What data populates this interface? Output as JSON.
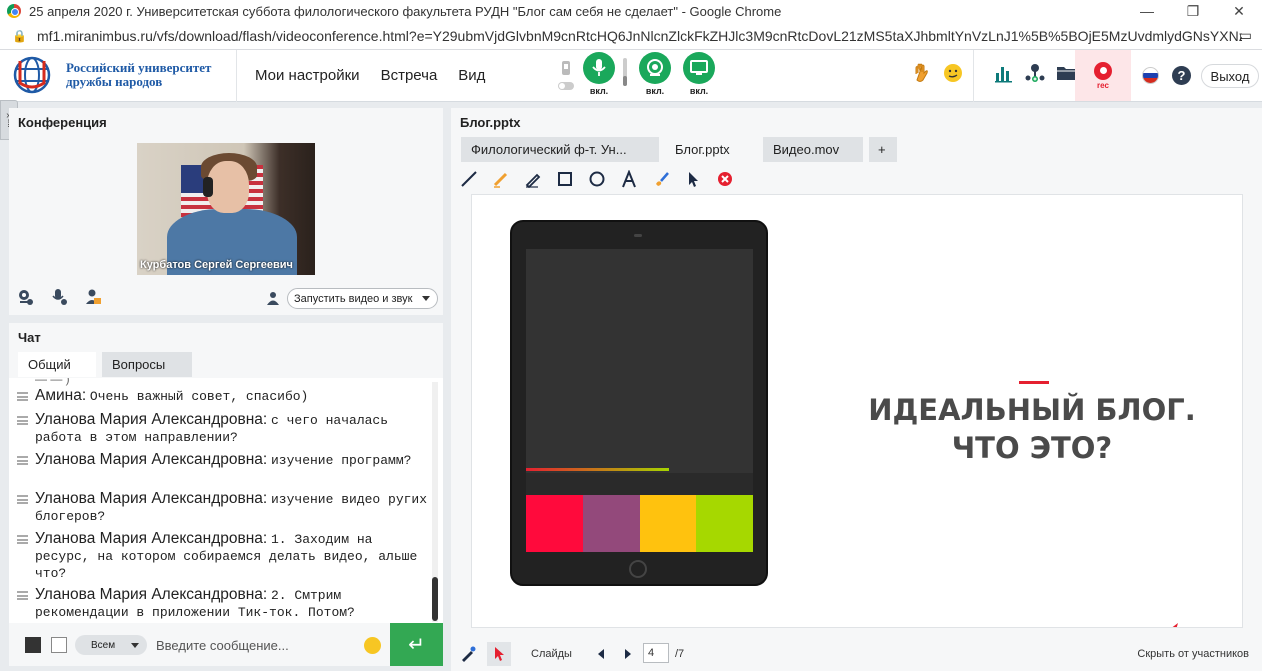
{
  "browser": {
    "title": "25 апреля 2020 г. Университетская суббота филологического факультета РУДН \"Блог сам себя не сделает\" - Google Chrome",
    "url": "mf1.miranimbus.ru/vfs/download/flash/videoconference.html?e=Y29ubmVjdGlvbnM9cnRtcHQ6JnNlcnZlckFkZHJlc3M9cnRtcDovL21zMS5taXJhbmltYnVzLnJ1%5B%5BOjE5MzUvdmlydGNsYXNzLy..."
  },
  "header": {
    "logo_line1": "Российский университет",
    "logo_line2": "дружбы народов",
    "menu": [
      "Мои настройки",
      "Встреча",
      "Вид"
    ],
    "mic_label": "вкл.",
    "cam_label": "вкл.",
    "screen_label": "вкл.",
    "rec_label": "rec",
    "exit_label": "Выход"
  },
  "conference": {
    "title": "Конференция",
    "participant_name": "Курбатов Сергей Сергеевич",
    "start_video_label": "Запустить видео и звук"
  },
  "chat": {
    "title": "Чат",
    "tabs": [
      "Общий",
      "Вопросы"
    ],
    "messages": [
      {
        "author": "Амина:",
        "text": "Очень важный совет, спасибо)"
      },
      {
        "author": "Уланова Мария  Александровна:",
        "text": "с чего началась работа в этом направлении?"
      },
      {
        "author": "Уланова Мария  Александровна:",
        "text": "изучение программ?"
      },
      {
        "author": "Уланова Мария  Александровна:",
        "text": "изучение видео ругих блогеров?"
      },
      {
        "author": "Уланова Мария  Александровна:",
        "text": "1. Заходим на ресурс, на котором собираемся делать видео, альше что?"
      },
      {
        "author": "Уланова Мария  Александровна:",
        "text": "2. Смтрим рекомендации в приложении Тик-ток. Потом?"
      }
    ],
    "recipient_select": "Всем",
    "input_placeholder": "Введите сообщение..."
  },
  "presentation": {
    "title": "Блог.pptx",
    "tabs": [
      "Филологический ф-т.  Ун...",
      "Блог.pptx",
      "Видео.mov",
      "+"
    ],
    "active_tab": 1,
    "slide_title_line1": "ИДЕАЛЬНЫЙ БЛОГ.",
    "slide_title_line2": "ЧТО ЭТО?",
    "swatch_colors": [
      "#ff0a3c",
      "#93497b",
      "#ffc20e",
      "#a6d800"
    ],
    "slides_label": "Слайды",
    "current_page": "4",
    "total_pages": "/7",
    "hide_label": "Скрыть от участников"
  }
}
